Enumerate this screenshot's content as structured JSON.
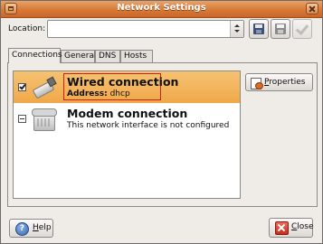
{
  "window": {
    "title": "Network Settings"
  },
  "location": {
    "label": "Location:",
    "value": ""
  },
  "toolbar": {
    "save_icon": "floppy-save-icon",
    "delete_icon": "floppy-delete-icon",
    "apply_icon": "checkmark-icon"
  },
  "tabs": [
    {
      "label": "Connections",
      "active": true
    },
    {
      "label": "General",
      "active": false
    },
    {
      "label": "DNS",
      "active": false
    },
    {
      "label": "Hosts",
      "active": false
    }
  ],
  "connections": [
    {
      "title": "Wired connection",
      "subtitle_key": "Address:",
      "subtitle_value": "dhcp",
      "enabled": true,
      "selected": true,
      "icon": "network-card-icon"
    },
    {
      "title": "Modem connection",
      "subtitle": "This network interface is not configured",
      "enabled": false,
      "selected": false,
      "icon": "modem-icon"
    }
  ],
  "buttons": {
    "properties_mnemonic": "P",
    "properties_rest": "roperties",
    "help_mnemonic": "H",
    "help_rest": "elp",
    "close_mnemonic": "C",
    "close_rest": "lose"
  },
  "colors": {
    "titlebar": "#d77a36",
    "selection": "#f0a84a",
    "selection_outline": "#d21e1e",
    "background": "#efebe7"
  }
}
